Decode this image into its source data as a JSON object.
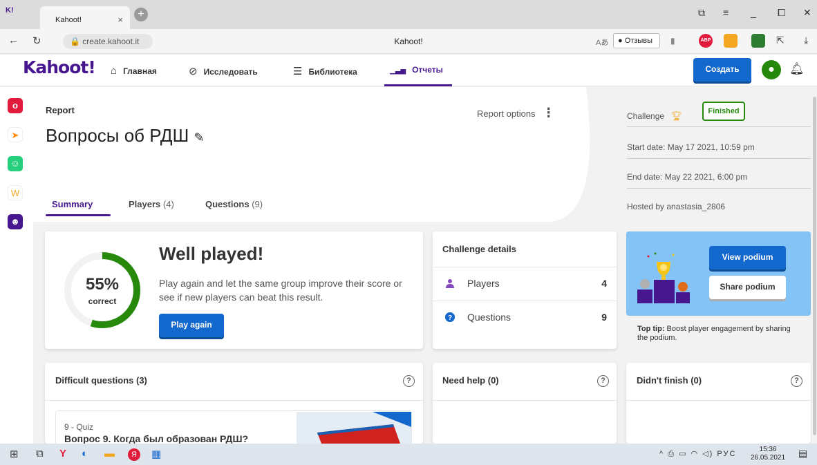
{
  "browser": {
    "tab_title": "Kahoot!",
    "tab_close": "×",
    "new_tab": "+",
    "url": "create.kahoot.it",
    "page_title": "Kahoot!",
    "reviews_label": "Отзывы",
    "window_controls": [
      "minimize",
      "maximize",
      "close"
    ]
  },
  "header": {
    "logo": "Kahoot!",
    "nav": [
      {
        "label": "Главная",
        "icon": "home-icon",
        "glyph": "⌂"
      },
      {
        "label": "Исследовать",
        "icon": "compass-icon",
        "glyph": "⊘"
      },
      {
        "label": "Библиотека",
        "icon": "list-icon",
        "glyph": "☰"
      },
      {
        "label": "Отчеты",
        "icon": "reports-icon",
        "glyph": "▁▃▅",
        "active": true
      }
    ],
    "create_label": "Создать"
  },
  "sidebar": {
    "apps": [
      {
        "name": "app-1",
        "color": "#e21b3c",
        "glyph": "o"
      },
      {
        "name": "app-2",
        "color": "#ffffff",
        "glyph": "➤"
      },
      {
        "name": "app-3",
        "color": "#26d07c",
        "glyph": "☺"
      },
      {
        "name": "app-4",
        "color": "#ffffff",
        "glyph": "W"
      },
      {
        "name": "app-5",
        "color": "#46178f",
        "glyph": "☻"
      }
    ]
  },
  "report": {
    "label": "Report",
    "title": "Вопросы об РДШ",
    "options_label": "Report options",
    "tabs": [
      {
        "label": "Summary",
        "count": ""
      },
      {
        "label": "Players",
        "count": "(4)"
      },
      {
        "label": "Questions",
        "count": "(9)"
      }
    ],
    "meta": {
      "challenge_label": "Challenge",
      "status": "Finished",
      "start": "Start date: May 17 2021, 10:59 pm",
      "end": "End date: May 22 2021, 6:00 pm",
      "host": "Hosted by anastasia_2806"
    }
  },
  "summary": {
    "percent": "55%",
    "percent_label": "correct",
    "percent_value": 0.55,
    "heading": "Well played!",
    "text": "Play again and let the same group improve their score or see if new players can beat this result.",
    "play_again": "Play again"
  },
  "challenge_details": {
    "title": "Challenge details",
    "rows": [
      {
        "label": "Players",
        "value": "4"
      },
      {
        "label": "Questions",
        "value": "9"
      }
    ]
  },
  "podium": {
    "view": "View podium",
    "share": "Share podium",
    "tip_bold": "Top tip:",
    "tip": " Boost player engagement by sharing the podium."
  },
  "bottom": {
    "difficult": "Difficult questions (3)",
    "need_help": "Need help (0)",
    "didnt_finish": "Didn't finish (0)",
    "help_glyph": "?",
    "question_num": "9 - Quiz",
    "question_text": "Вопрос 9. Когда был образован РДШ?"
  },
  "taskbar": {
    "time": "15:36",
    "date": "26.05.2021",
    "lang": "РУС"
  },
  "colors": {
    "brand": "#46178f",
    "blue": "#1368ce",
    "green": "#26890c",
    "podium_bg": "#83c3f6"
  }
}
